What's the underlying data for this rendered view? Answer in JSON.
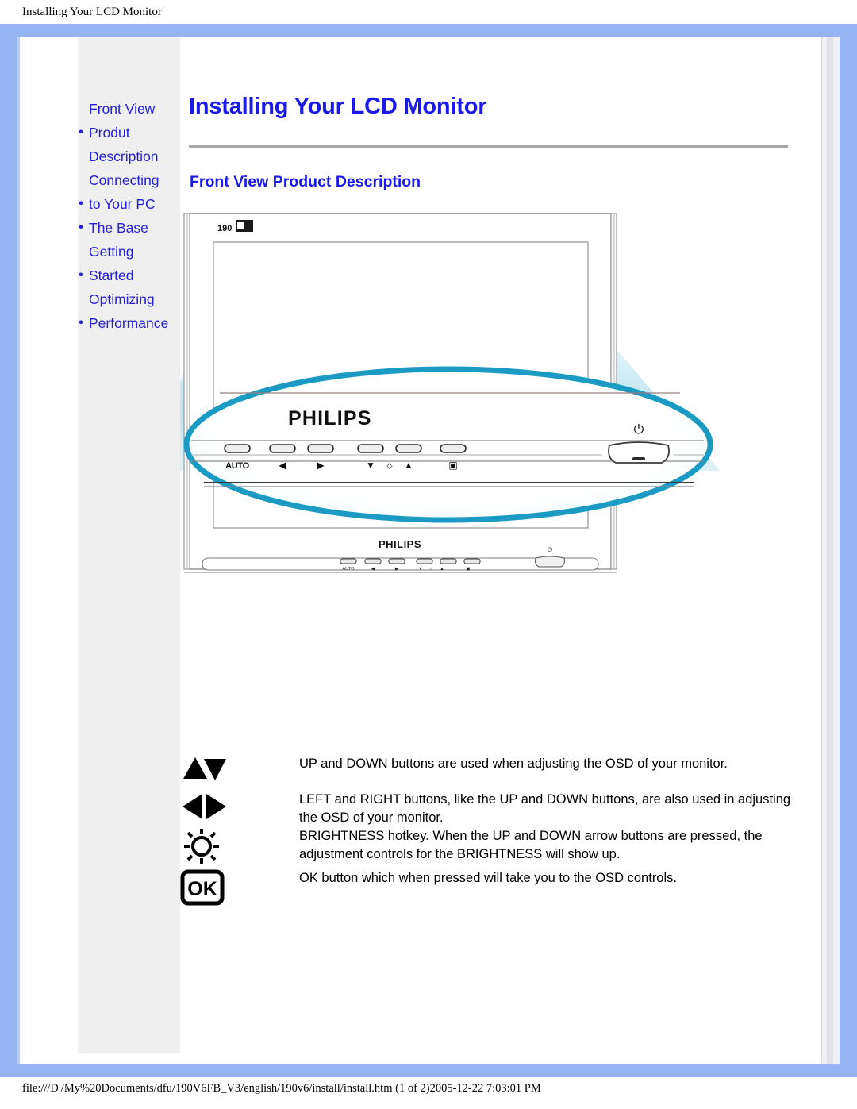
{
  "print": {
    "header": "Installing Your LCD Monitor",
    "footer": "file:///D|/My%20Documents/dfu/190V6FB_V3/english/190v6/install/install.htm (1 of 2)2005-12-22 7:03:01 PM"
  },
  "colors": {
    "frame_blue": "#97b4f2",
    "link_blue": "#2222dd",
    "heading_blue": "#1a1aee",
    "sidebar_gray": "#efefef",
    "callout_teal": "#1b9bc4",
    "beam_blue": "#cfeaf3"
  },
  "sidebar": {
    "items": [
      {
        "label": "Front View",
        "bulleted": false
      },
      {
        "label": "Produt",
        "bulleted": true
      },
      {
        "label": "Description",
        "bulleted": false
      },
      {
        "label": "Connecting",
        "bulleted": false
      },
      {
        "label": "to Your PC",
        "bulleted": true
      },
      {
        "label": "The Base",
        "bulleted": true
      },
      {
        "label": "Getting",
        "bulleted": false
      },
      {
        "label": "Started",
        "bulleted": true
      },
      {
        "label": "Optimizing",
        "bulleted": false
      },
      {
        "label": "Performance",
        "bulleted": true
      }
    ]
  },
  "main": {
    "page_title": "Installing Your LCD Monitor",
    "section_title": "Front View Product Description"
  },
  "figure": {
    "monitor": {
      "model_badge": "190",
      "brand": "PHILIPS",
      "bezel_buttons": [
        {
          "label": "AUTO",
          "name": "auto-button"
        },
        {
          "label": "◄",
          "name": "left-button"
        },
        {
          "label": "►",
          "name": "right-button"
        },
        {
          "label": "▼",
          "name": "down-button"
        },
        {
          "label": "☼",
          "name": "brightness-button"
        },
        {
          "label": "▲",
          "name": "up-button"
        },
        {
          "label": "▣",
          "name": "ok-menu-button"
        }
      ],
      "power_symbol": "⏻"
    },
    "callout": {
      "brand": "PHILIPS",
      "buttons": [
        {
          "label": "AUTO"
        },
        {
          "label": "◄"
        },
        {
          "label": "►"
        },
        {
          "label": "▼"
        },
        {
          "label": "☼"
        },
        {
          "label": "▲"
        },
        {
          "label": "▣"
        }
      ],
      "power_symbol": "⏻"
    }
  },
  "button_descriptions": [
    {
      "icon": "up-down-arrows-icon",
      "text": "UP and DOWN buttons are used when adjusting the OSD of your monitor."
    },
    {
      "icon": "left-right-arrows-icon",
      "text": "LEFT and RIGHT buttons, like the UP and DOWN buttons, are also used in adjusting the OSD of your monitor."
    },
    {
      "icon": "brightness-icon",
      "text": "BRIGHTNESS hotkey. When the UP and DOWN arrow buttons are pressed, the adjustment controls for the BRIGHTNESS will show up."
    },
    {
      "icon": "ok-icon",
      "text": "OK button which when pressed will take you to the OSD controls."
    }
  ]
}
